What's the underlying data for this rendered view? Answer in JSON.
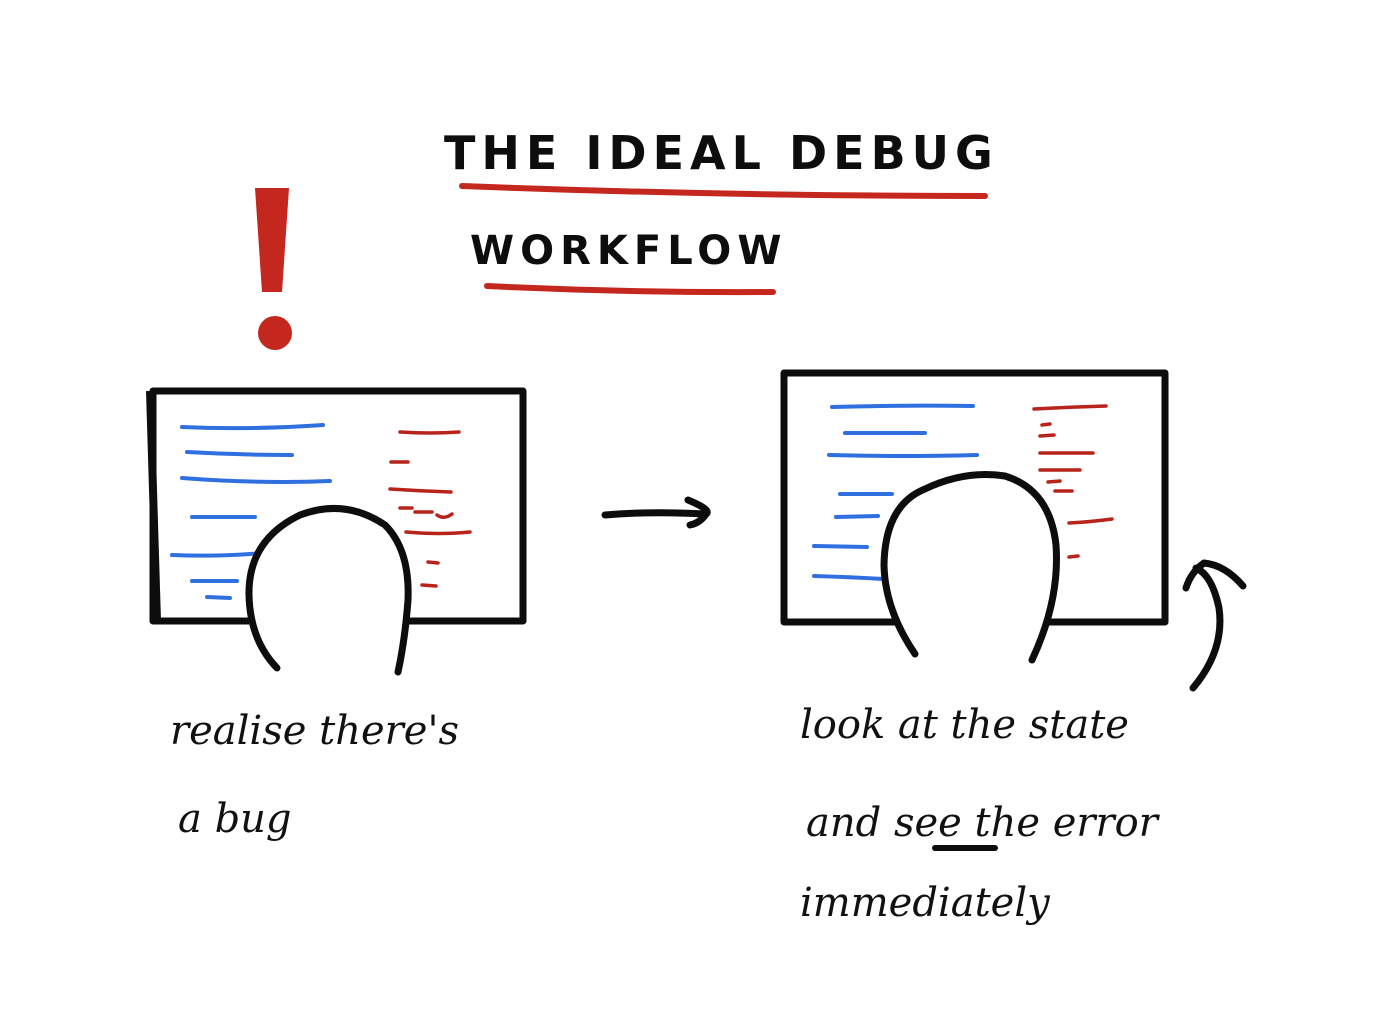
{
  "title": {
    "line1": "THE IDEAL DEBUG",
    "line2": "WORKFLOW"
  },
  "left_panel": {
    "caption_line1": "realise there's",
    "caption_line2": "a bug"
  },
  "right_panel": {
    "caption_line1": "look at the state",
    "caption_line2_part1": "and ",
    "caption_line2_emph": "see",
    "caption_line2_part2": " the error",
    "caption_line3": "immediately"
  },
  "colors": {
    "ink": "#0d0d0d",
    "accent_red": "#c4271d",
    "code_blue": "#2f6fe0",
    "code_red": "#b8231b"
  },
  "icons": {
    "alert": "exclamation-mark-icon",
    "transition": "right-arrow-icon",
    "pointer": "curved-up-arrow-icon"
  }
}
